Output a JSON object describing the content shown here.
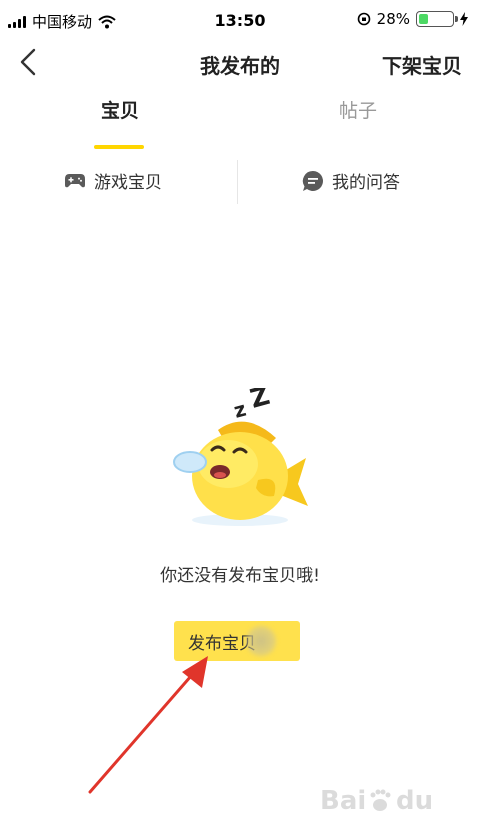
{
  "status_bar": {
    "carrier": "中国移动",
    "time": "13:50",
    "battery_percent": "28%",
    "battery_level": 0.28
  },
  "nav": {
    "title": "我发布的",
    "action_label": "下架宝贝"
  },
  "tabs": [
    {
      "label": "宝贝",
      "active": true
    },
    {
      "label": "帖子",
      "active": false
    }
  ],
  "subtabs": [
    {
      "label": "游戏宝贝",
      "icon": "gamepad-icon"
    },
    {
      "label": "我的问答",
      "icon": "chat-bubble-icon"
    }
  ],
  "empty_state": {
    "message": "你还没有发布宝贝哦!",
    "button_label": "发布宝贝"
  },
  "colors": {
    "accent": "#ffd600",
    "button_bg": "#ffe14d",
    "battery_green": "#4cd964"
  }
}
